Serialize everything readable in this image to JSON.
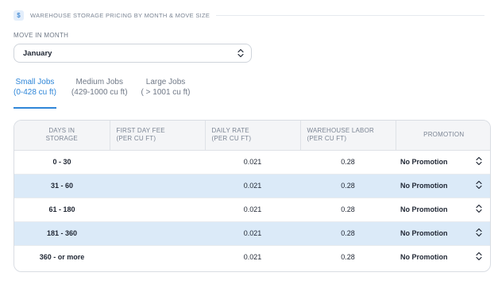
{
  "header": {
    "icon": "dollar-icon",
    "icon_glyph": "$",
    "title": "WAREHOUSE STORAGE PRICING BY MONTH & MOVE SIZE"
  },
  "month": {
    "label": "MOVE IN MONTH",
    "value": "January"
  },
  "tabs": [
    {
      "line1": "Small Jobs",
      "line2": "(0-428 cu ft)",
      "active": true
    },
    {
      "line1": "Medium Jobs",
      "line2": "(429-1000 cu ft)",
      "active": false
    },
    {
      "line1": "Large Jobs",
      "line2": "( > 1001 cu ft)",
      "active": false
    }
  ],
  "table": {
    "headers": [
      {
        "line1": "DAYS IN",
        "line2": "STORAGE"
      },
      {
        "line1": "FIRST DAY FEE",
        "line2": "(PER CU FT)"
      },
      {
        "line1": "DAILY RATE",
        "line2": "(PER CU FT)"
      },
      {
        "line1": "WAREHOUSE LABOR",
        "line2": "(PER CU FT)"
      },
      {
        "line1": "PROMOTION",
        "line2": ""
      }
    ],
    "rows": [
      {
        "days": "0 - 30",
        "first_day_fee": "",
        "daily_rate": "0.021",
        "labor": "0.28",
        "promotion": "No Promotion"
      },
      {
        "days": "31 - 60",
        "first_day_fee": "",
        "daily_rate": "0.021",
        "labor": "0.28",
        "promotion": "No Promotion"
      },
      {
        "days": "61 - 180",
        "first_day_fee": "",
        "daily_rate": "0.021",
        "labor": "0.28",
        "promotion": "No Promotion"
      },
      {
        "days": "181 - 360",
        "first_day_fee": "",
        "daily_rate": "0.021",
        "labor": "0.28",
        "promotion": "No Promotion"
      },
      {
        "days": "360 - or more",
        "first_day_fee": "",
        "daily_rate": "0.021",
        "labor": "0.28",
        "promotion": "No Promotion"
      }
    ]
  },
  "colors": {
    "accent": "#2f86d8",
    "row_highlight": "#dbeaf8",
    "header_bg": "#f4f5f7"
  }
}
